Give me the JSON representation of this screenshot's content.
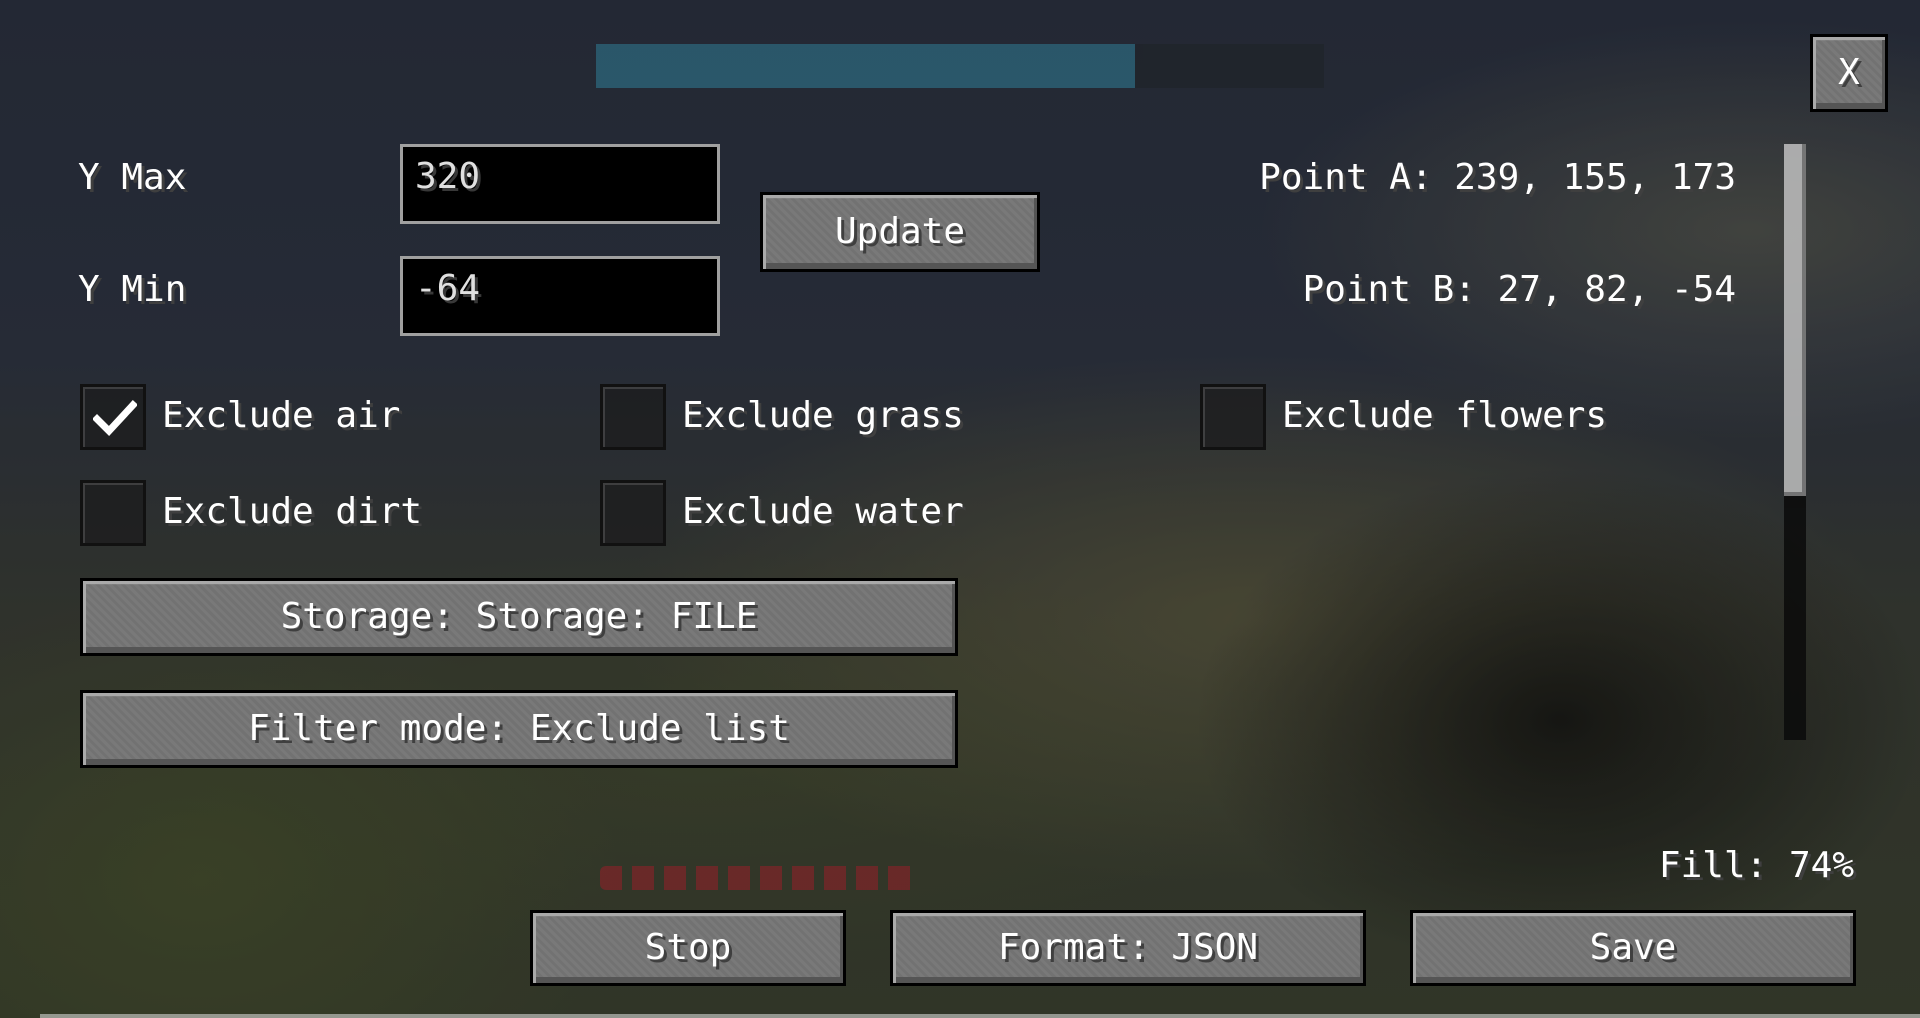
{
  "settings": {
    "y_max_label": "Y Max",
    "y_max_value": "320",
    "y_min_label": "Y Min",
    "y_min_value": "-64",
    "update_button": "Update",
    "point_a": "Point A: 239, 155, 173",
    "point_b": "Point B: 27, 82, -54"
  },
  "filters": [
    {
      "label": "Exclude air",
      "checked": true
    },
    {
      "label": "Exclude grass",
      "checked": false
    },
    {
      "label": "Exclude flowers",
      "checked": false
    },
    {
      "label": "Exclude dirt",
      "checked": false
    },
    {
      "label": "Exclude water",
      "checked": false
    }
  ],
  "storage_button": "Storage: Storage: FILE",
  "filter_mode_button": "Filter mode: Exclude list",
  "fill": {
    "label": "Fill: 74%",
    "value": 0.74
  },
  "footer": {
    "stop": "Stop",
    "format": "Format: JSON",
    "save": "Save"
  },
  "close_button": "X",
  "scroll_position": 0.0,
  "colors": {
    "progress": "#2f7d96",
    "text": "#ffffff",
    "field_bg": "#000000",
    "field_border": "#a0a0a0"
  }
}
